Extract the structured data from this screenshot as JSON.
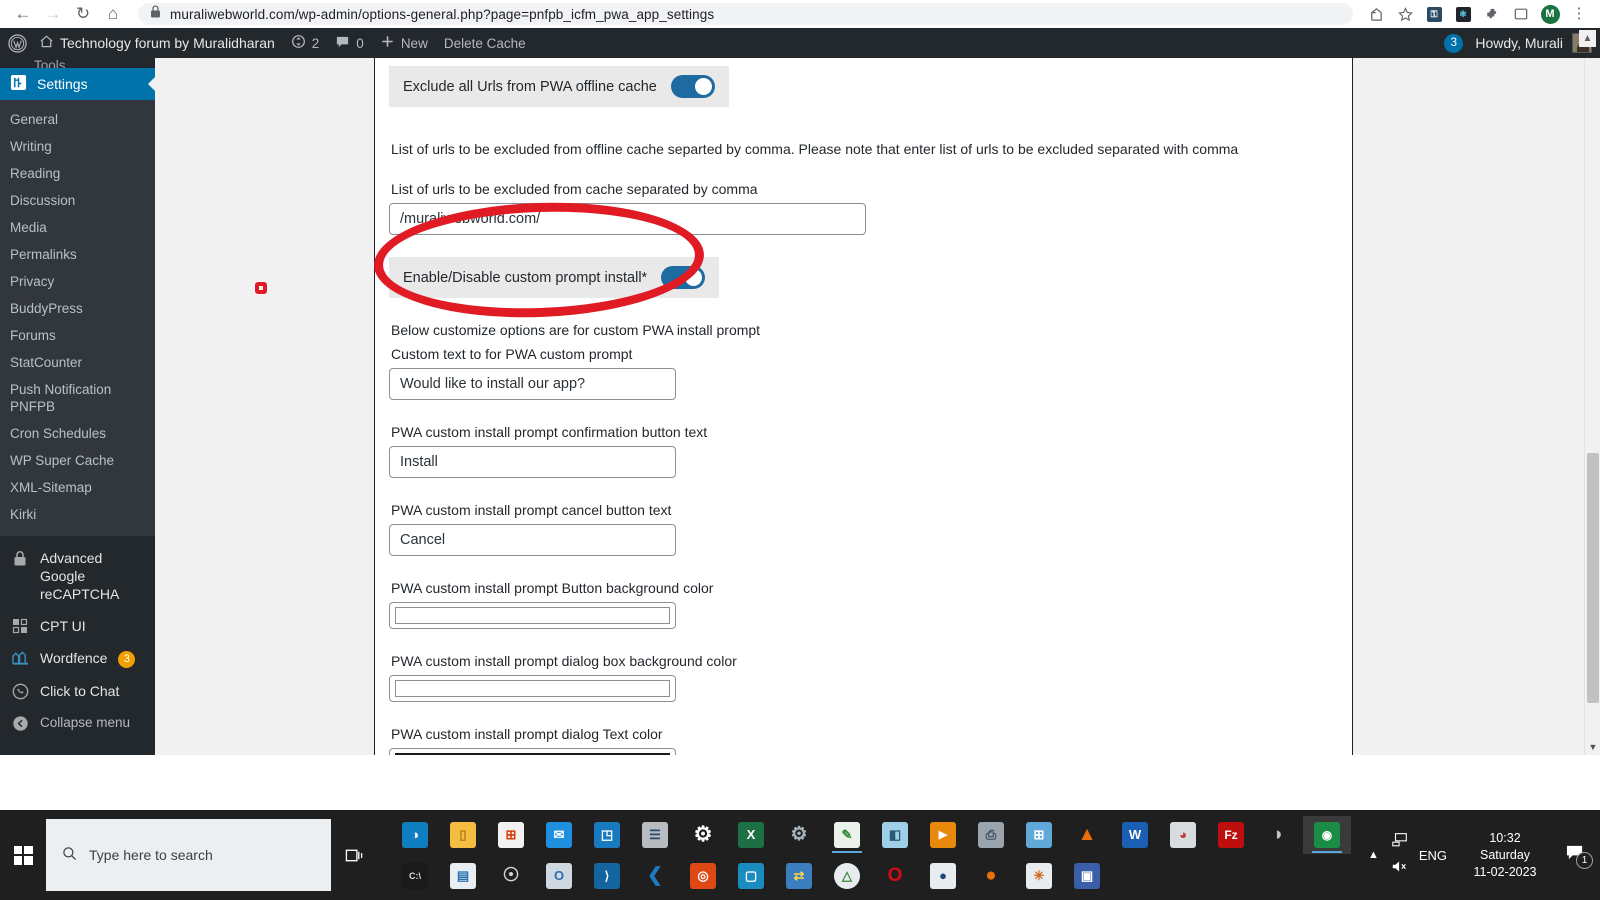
{
  "browser": {
    "back_icon": "back-arrow-icon",
    "forward_icon": "forward-arrow-icon",
    "reload_icon": "reload-icon",
    "home_icon": "home-icon",
    "lock_icon": "lock-icon",
    "url": "muraliwebworld.com/wp-admin/options-general.php?page=pnfpb_icfm_pwa_app_settings",
    "share_icon": "share-icon",
    "bookmark_icon": "star-icon",
    "extensions": [
      {
        "name": "shield-extension-icon",
        "glyph": "⛊",
        "color": "#2b4a63"
      },
      {
        "name": "react-extension-icon",
        "glyph": "⚛",
        "color": "#20232a"
      },
      {
        "name": "puzzle-extension-icon",
        "glyph": "❖",
        "color": "#5f6368"
      },
      {
        "name": "sidepanel-icon",
        "glyph": "▢",
        "color": "#5f6368"
      }
    ],
    "profile_initial": "M",
    "menu_icon": "kebab-menu-icon"
  },
  "adminbar": {
    "wp_logo": "wordpress-logo-icon",
    "home_icon": "home-icon",
    "site_name": "Technology forum by Muralidharan",
    "updates_icon": "updates-icon",
    "updates_count": "2",
    "comments_icon": "comment-bubble-icon",
    "comments_count": "0",
    "new_icon": "plus-icon",
    "new_label": "New",
    "delete_cache_label": "Delete Cache",
    "notification_count": "3",
    "howdy": "Howdy, Murali",
    "avatar": "user-avatar"
  },
  "sidebar": {
    "cut_off_label": "Tools",
    "active_menu": {
      "label": "Settings",
      "icon": "settings-gear-icon"
    },
    "submenu": [
      {
        "label": "General"
      },
      {
        "label": "Writing"
      },
      {
        "label": "Reading"
      },
      {
        "label": "Discussion"
      },
      {
        "label": "Media"
      },
      {
        "label": "Permalinks"
      },
      {
        "label": "Privacy"
      },
      {
        "label": "BuddyPress"
      },
      {
        "label": "Forums"
      },
      {
        "label": "StatCounter"
      },
      {
        "label": "Push Notification PNFPB",
        "line1": "Push Notification",
        "line2": "PNFPB"
      },
      {
        "label": "Cron Schedules"
      },
      {
        "label": "WP Super Cache"
      },
      {
        "label": "XML-Sitemap"
      },
      {
        "label": "Kirki"
      }
    ],
    "plugins": [
      {
        "label": "Advanced Google reCAPTCHA",
        "line1": "Advanced Google",
        "line2": "reCAPTCHA",
        "icon": "lock-icon"
      },
      {
        "label": "CPT UI",
        "icon": "grid-squares-icon"
      },
      {
        "label": "Wordfence",
        "icon": "wordfence-icon",
        "badge": "3"
      },
      {
        "label": "Click to Chat",
        "icon": "whatsapp-icon"
      }
    ],
    "collapse": {
      "label": "Collapse menu",
      "icon": "collapse-arrow-icon"
    }
  },
  "form": {
    "exclude_toggle": {
      "label": "Exclude all Urls from PWA offline cache",
      "state": "on"
    },
    "helper_text": "List of urls to be excluded from offline cache separted by comma. Please note that enter list of urls to be excluded separated with comma",
    "urls_label": "List of urls to be excluded from cache separated by comma",
    "urls_value": "/muraliwebworld.com/",
    "custom_prompt_toggle": {
      "label": "Enable/Disable custom prompt install*",
      "state": "on"
    },
    "customize_note": "Below customize options are for custom PWA install prompt",
    "custom_text_label": "Custom text to for PWA custom prompt",
    "custom_text_value": "Would like to install our app?",
    "confirm_btn_label": "PWA custom install prompt confirmation button text",
    "confirm_btn_value": "Install",
    "cancel_btn_label": "PWA custom install prompt cancel button text",
    "cancel_btn_value": "Cancel",
    "btn_bg_label": "PWA custom install prompt Button background color",
    "btn_bg_color": "#ffffff",
    "dialog_bg_label": "PWA custom install prompt dialog box background color",
    "dialog_bg_color": "#ffffff",
    "dialog_text_label": "PWA custom install prompt dialog Text color",
    "dialog_text_color": "#1a1a1a"
  },
  "annotations": {
    "ellipse_color": "#e01b24",
    "dot_color": "#e01b24"
  },
  "taskbar": {
    "start_icon": "windows-start-icon",
    "search_icon": "search-icon",
    "search_placeholder": "Type here to search",
    "taskview_icon": "task-view-icon",
    "apps_row1": [
      {
        "name": "edge-icon",
        "glyph": "◑",
        "color": "#0f7ec1"
      },
      {
        "name": "file-explorer-icon",
        "glyph": "▬",
        "color": "#f5bc42"
      },
      {
        "name": "microsoft-store-icon",
        "glyph": "⊞",
        "color": "#f2f2f2"
      },
      {
        "name": "mail-icon",
        "glyph": "✉",
        "color": "#1f8fe0"
      },
      {
        "name": "powerpoint-icon",
        "glyph": "◳",
        "color": "#1a7ac0"
      },
      {
        "name": "monitor-chart-icon",
        "glyph": "☰",
        "color": "#b8bcc0"
      },
      {
        "name": "settings-gear-icon",
        "glyph": "⚙",
        "color": "#ffffff"
      },
      {
        "name": "excel-icon",
        "glyph": "X",
        "color": "#1d7044"
      },
      {
        "name": "gears-icon",
        "glyph": "⚙",
        "color": "#a8b4bc"
      },
      {
        "name": "notepad-edit-icon",
        "glyph": "✎",
        "color": "#4caf50",
        "running": true
      },
      {
        "name": "sticky-notes-icon",
        "glyph": "◧",
        "color": "#9fd0e8"
      },
      {
        "name": "media-player-icon",
        "glyph": "▶",
        "color": "#e8890c"
      },
      {
        "name": "scanner-icon",
        "glyph": "⎙",
        "color": "#9aa4ac"
      },
      {
        "name": "calculator-icon",
        "glyph": "⊞",
        "color": "#5fa8d8"
      },
      {
        "name": "vlc-icon",
        "glyph": "▲",
        "color": "#e8700a"
      },
      {
        "name": "word-icon",
        "glyph": "W",
        "color": "#1a5fb4"
      },
      {
        "name": "paint-icon",
        "glyph": "◕",
        "color": "#d8dce0"
      },
      {
        "name": "filezilla-icon",
        "glyph": "Fz",
        "color": "#bf0e0e"
      },
      {
        "name": "speaker-icon",
        "glyph": "◗",
        "color": "#c0c4c8"
      },
      {
        "name": "chrome-icon",
        "glyph": "◉",
        "color": "#1a8c43",
        "active": true
      }
    ],
    "apps_row2": [
      {
        "name": "terminal-icon",
        "glyph": "⬛",
        "color": "#1a1a1a"
      },
      {
        "name": "reader-icon",
        "glyph": "▤",
        "color": "#6aa9d8"
      },
      {
        "name": "satellite-icon",
        "glyph": "☉",
        "color": "#cfd4d8"
      },
      {
        "name": "outlook-icon",
        "glyph": "O",
        "color": "#2a6fb0"
      },
      {
        "name": "powershell-icon",
        "glyph": "〉",
        "color": "#1464a0"
      },
      {
        "name": "vscode-icon",
        "glyph": "⬡",
        "color": "#1a7ac0"
      },
      {
        "name": "ubuntu-icon",
        "glyph": "◎",
        "color": "#dd4814"
      },
      {
        "name": "virtualbox-icon",
        "glyph": "⬚",
        "color": "#1a8cc0"
      },
      {
        "name": "network-transfer-icon",
        "glyph": "⇄",
        "color": "#3a7ec0"
      },
      {
        "name": "android-studio-icon",
        "glyph": "△",
        "color": "#e8ecef"
      },
      {
        "name": "opera-icon",
        "glyph": "O",
        "color": "#d60a16"
      },
      {
        "name": "linux-icon",
        "glyph": "●",
        "color": "#e8ecef"
      },
      {
        "name": "firefox-icon",
        "glyph": "●",
        "color": "#e8700a"
      },
      {
        "name": "colorful-app-icon",
        "glyph": "✳",
        "color": "#e8ecef"
      },
      {
        "name": "remote-desktop-icon",
        "glyph": "▣",
        "color": "#3a5fa8"
      }
    ],
    "tray": {
      "chevron_icon": "chevron-up-icon",
      "network_icon": "network-icon",
      "volume_icon": "volume-muted-icon",
      "language": "ENG",
      "time": "10:32",
      "day": "Saturday",
      "date": "11-02-2023",
      "notification_icon": "notification-icon",
      "notification_count": "1"
    }
  }
}
